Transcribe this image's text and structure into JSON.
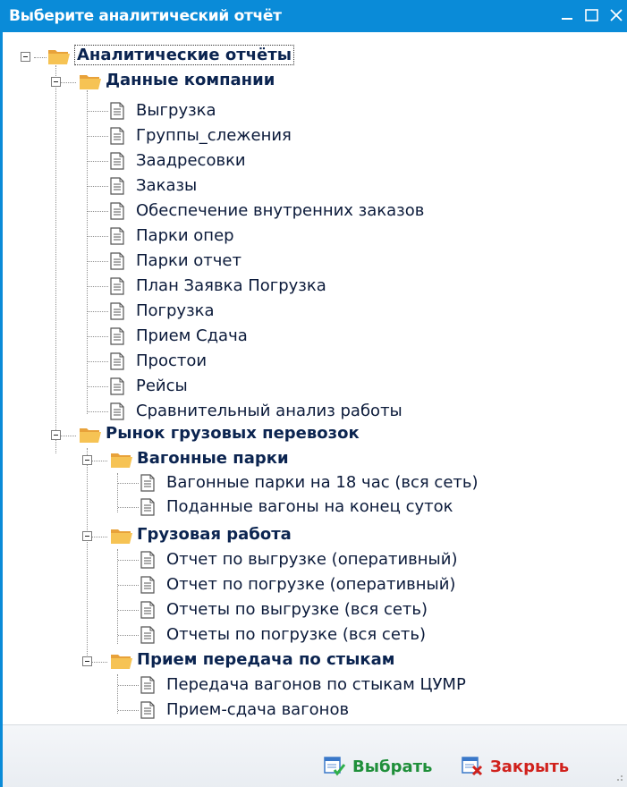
{
  "window": {
    "title": "Выберите аналитический отчёт",
    "accent": "#0a8bd8"
  },
  "tree": {
    "root": "Аналитические отчёты",
    "company": {
      "label": "Данные компании",
      "items": [
        "Выгрузка",
        "Группы_слежения",
        "Заадресовки",
        "Заказы",
        "Обеспечение внутренних заказов",
        "Парки опер",
        "Парки отчет",
        "План Заявка Погрузка",
        "Погрузка",
        "Прием Сдача",
        "Простои",
        "Рейсы",
        "Сравнительный анализ работы"
      ]
    },
    "market": {
      "label": "Рынок грузовых перевозок",
      "wagon_parks": {
        "label": "Вагонные парки",
        "items": [
          "Вагонные парки на 18 час (вся сеть)",
          "Поданные вагоны на конец суток"
        ]
      },
      "cargo_work": {
        "label": "Грузовая работа",
        "items": [
          "Отчет по выгрузке (оперативный)",
          "Отчет по погрузке (оперативный)",
          "Отчеты по выгрузке (вся сеть)",
          "Отчеты по погрузке (вся сеть)"
        ]
      },
      "junctions": {
        "label": "Прием передача по стыкам",
        "items": [
          "Передача вагонов по стыкам ЦУМР",
          "Прием-сдача вагонов"
        ]
      }
    }
  },
  "footer": {
    "select_label": "Выбрать",
    "close_label": "Закрыть",
    "select_color": "#1f8f3a",
    "close_color": "#d0211c"
  }
}
